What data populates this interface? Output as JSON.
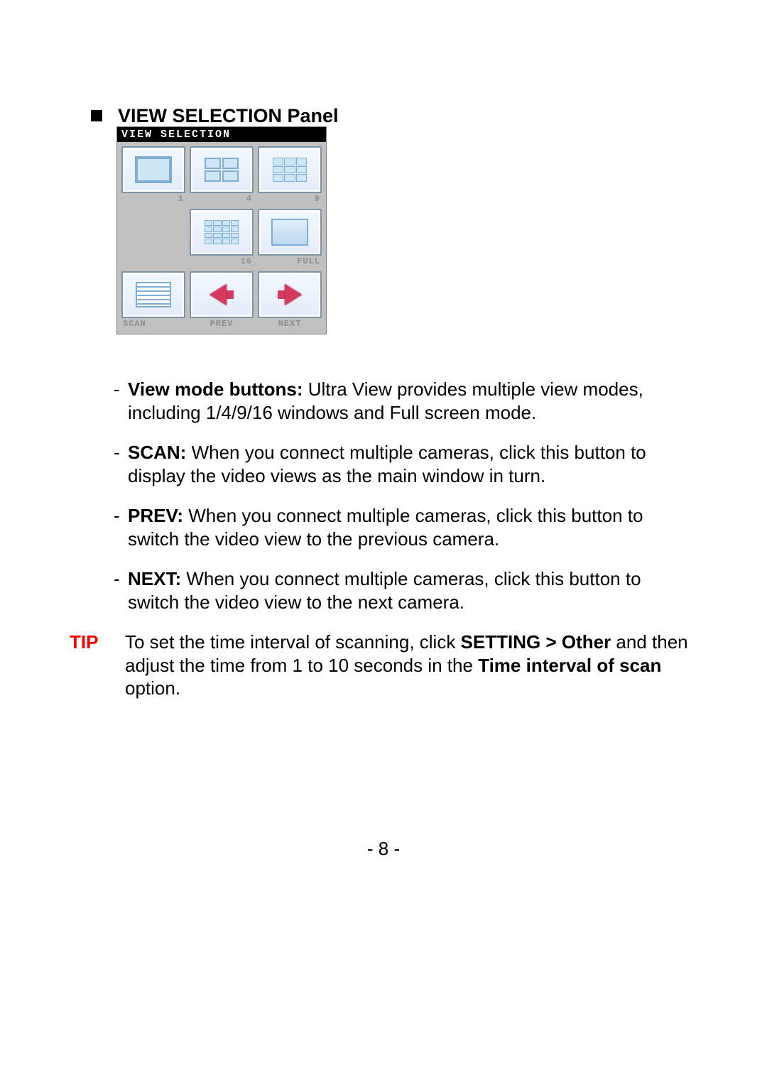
{
  "heading": "VIEW SELECTION Panel",
  "panel": {
    "title": "VIEW SELECTION",
    "buttons": {
      "b1": "1",
      "b4": "4",
      "b9": "9",
      "b16": "16",
      "full": "FULL",
      "scan": "SCAN",
      "prev": "PREV",
      "next": "NEXT"
    }
  },
  "bullets": {
    "b1_lead": "View mode buttons:",
    "b1_rest": " Ultra View provides multiple view modes, including 1/4/9/16 windows and Full screen mode.",
    "b2_lead": "SCAN:",
    "b2_rest": " When you connect multiple cameras, click this button to display the video views as the main window in turn.",
    "b3_lead": "PREV:",
    "b3_rest": " When you connect multiple cameras, click this button to switch the video view to the previous camera.",
    "b4_lead": "NEXT:",
    "b4_rest": " When you connect multiple cameras, click this button to switch the video view to the next camera."
  },
  "tip": {
    "label": "TIP",
    "t1": "To set the time interval of scanning, click ",
    "t_setting": "SETTING > Other",
    "t2": " and then adjust the time from 1 to 10 seconds in the ",
    "t_opt": "Time interval of scan",
    "t3": " option."
  },
  "page_number": "- 8 -"
}
